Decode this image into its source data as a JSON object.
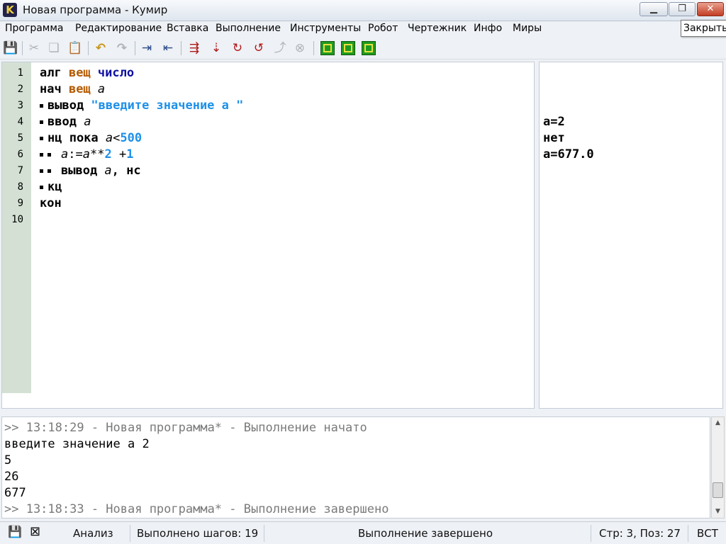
{
  "window": {
    "icon_letter": "K",
    "title": "Новая программа - Кумир",
    "min_glyph": "▁",
    "max_glyph": "❐",
    "close_glyph": "✕",
    "tooltip": "Закрыть"
  },
  "menu": [
    "Программа",
    "Редактирование",
    "Вставка",
    "Выполнение",
    "Инструменты",
    "Робот",
    "Чертежник",
    "Инфо",
    "Миры"
  ],
  "toolbar": {
    "icons": [
      "save-icon",
      "cut-icon",
      "copy-icon",
      "paste-icon",
      "undo-icon",
      "redo-icon",
      "indent-icon",
      "unindent-icon",
      "run-icon",
      "step-run-icon",
      "step-over-icon",
      "step-in-icon",
      "step-out-icon",
      "stop-icon",
      "robot-grid-icon",
      "robot-frame-icon",
      "draftsman-icon"
    ],
    "glyphs": {
      "save": "💾",
      "cut": "✂",
      "copy": "❏",
      "paste": "📋",
      "undo": "↶",
      "redo": "↷",
      "indent": "⇥",
      "unindent": "⇤",
      "run": "⇶",
      "step": "⇣",
      "step_over": "↻",
      "step_in": "↺",
      "step_out": "⤴",
      "stop": "⊗"
    }
  },
  "editor": {
    "line_numbers": [
      "1",
      "2",
      "3",
      "4",
      "5",
      "6",
      "7",
      "8",
      "9",
      "10"
    ],
    "lines": {
      "l1": {
        "kw": "алг ",
        "ty": "вещ ",
        "fn": "число"
      },
      "l2": {
        "kw": "нач ",
        "ty": "вещ ",
        "var": "а"
      },
      "l3": {
        "kw": "вывод ",
        "str": "\"введите значение а \""
      },
      "l4": {
        "kw": "ввод ",
        "var": "а"
      },
      "l5": {
        "kw": "нц пока ",
        "var": "а",
        "op": "<",
        "num": "500"
      },
      "l6": {
        "var1": "а",
        "op1": ":=",
        "var2": "а",
        "op2": "**",
        "num1": "2",
        "op3": " +",
        "num2": "1"
      },
      "l7": {
        "kw": "вывод ",
        "var": "а",
        "rest": ", нс"
      },
      "l8": {
        "kw": "кц"
      },
      "l9": {
        "kw": "кон"
      }
    }
  },
  "margin": {
    "lines": [
      "а=2",
      "нет",
      "а=677.0"
    ]
  },
  "console": {
    "lines": [
      ">> 13:18:29 - Новая программа* - Выполнение начато",
      "введите значение а 2",
      "5",
      "26",
      "677",
      ">> 13:18:33 - Новая программа* - Выполнение завершено"
    ]
  },
  "statusbar": {
    "mode": "Анализ",
    "steps": "Выполнено шагов: 19",
    "state": "Выполнение завершено",
    "position": "Стр: 3, Поз: 27",
    "insert": "ВСТ"
  }
}
